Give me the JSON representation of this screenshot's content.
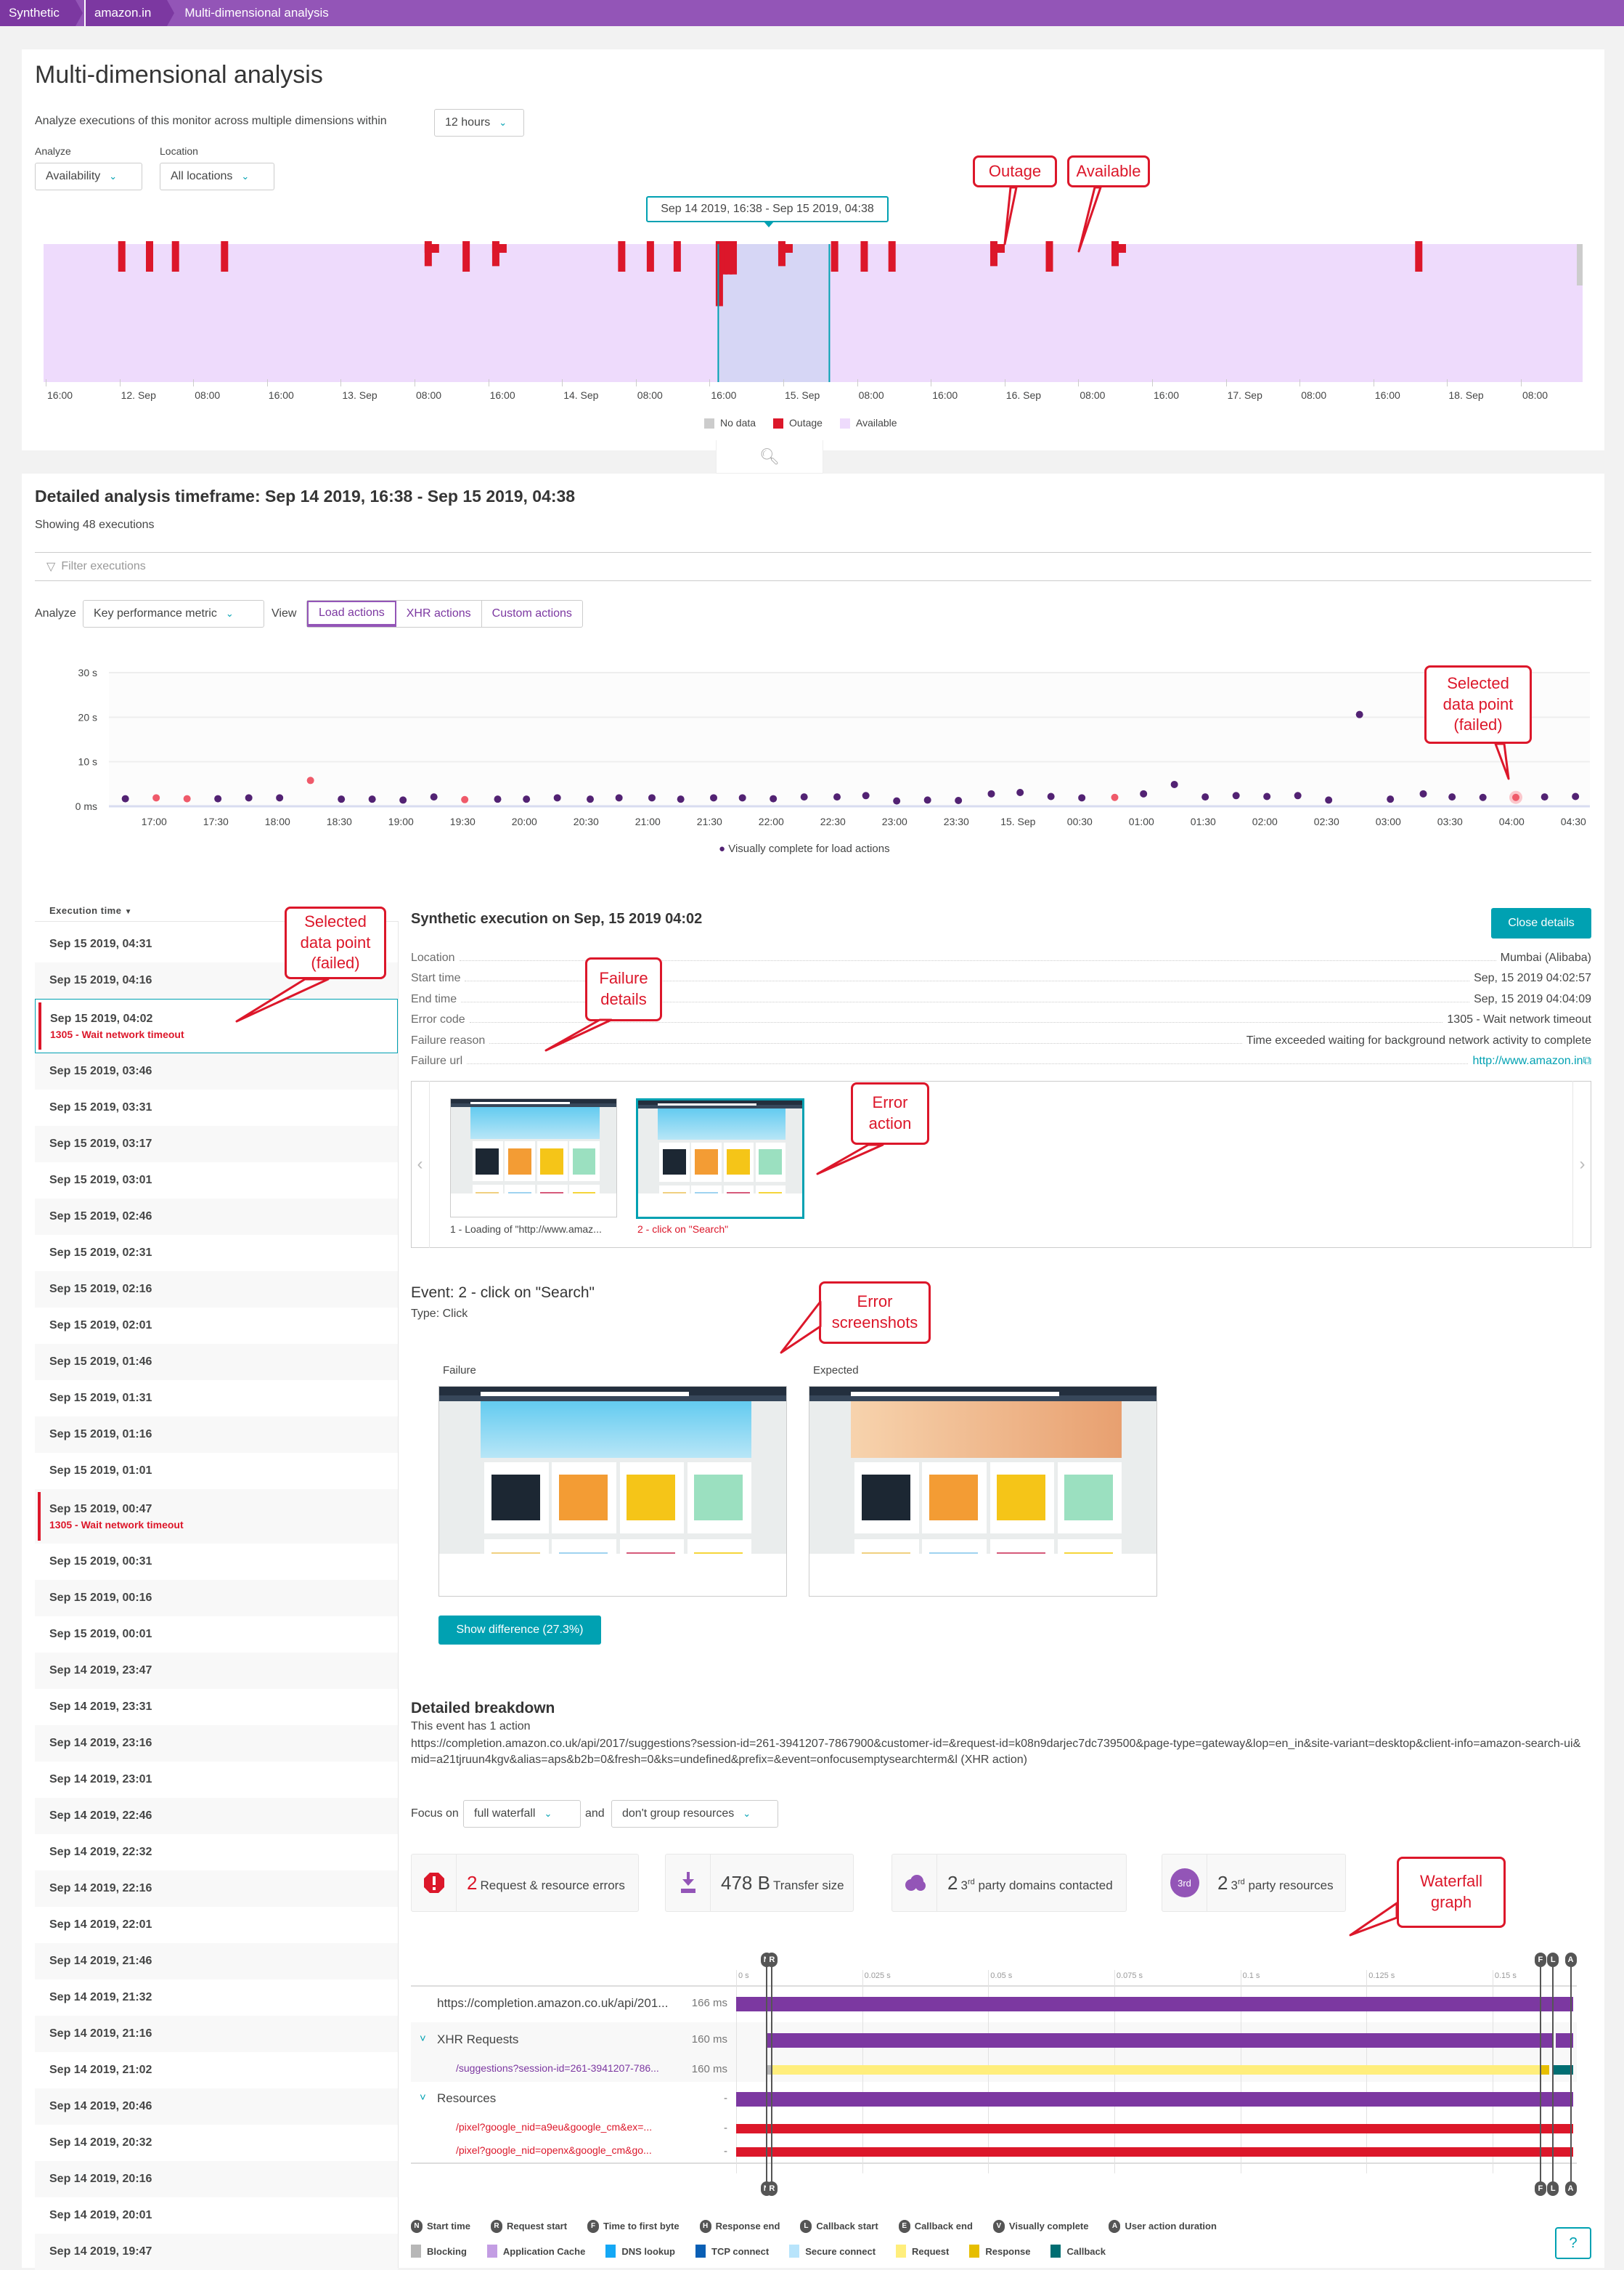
{
  "breadcrumb": [
    "Synthetic",
    "amazon.in",
    "Multi-dimensional analysis"
  ],
  "header": {
    "title": "Multi-dimensional analysis",
    "subtitle": "Analyze executions of this monitor across multiple dimensions within",
    "timeframe": "12 hours",
    "analyze_label": "Analyze",
    "analyze_value": "Availability",
    "location_label": "Location",
    "location_value": "All locations",
    "selection_tooltip": "Sep 14 2019, 16:38 - Sep 15 2019, 04:38"
  },
  "availability_chart": {
    "type": "timeline",
    "range": [
      "2019-09-11T15:45",
      "2019-09-18T14:00"
    ],
    "tick_labels": [
      "16:00",
      "12. Sep",
      "08:00",
      "16:00",
      "13. Sep",
      "08:00",
      "16:00",
      "14. Sep",
      "08:00",
      "16:00",
      "15. Sep",
      "08:00",
      "16:00",
      "16. Sep",
      "08:00",
      "16:00",
      "17. Sep",
      "08:00",
      "16:00",
      "18. Sep",
      "08:00"
    ],
    "selection": [
      "2019-09-14T16:38",
      "2019-09-15T04:38"
    ],
    "outages": [
      {
        "time": "2019-09-12T00:12",
        "outage_pct": 20
      },
      {
        "time": "2019-09-12T03:12",
        "outage_pct": 20
      },
      {
        "time": "2019-09-12T06:00",
        "outage_pct": 20
      },
      {
        "time": "2019-09-12T11:18",
        "outage_pct": 20
      },
      {
        "time": "2019-09-13T09:18",
        "outage_pct": 16
      },
      {
        "time": "2019-09-13T13:24",
        "outage_pct": 20
      },
      {
        "time": "2019-09-13T16:36",
        "outage_pct": 16
      },
      {
        "time": "2019-09-14T06:12",
        "outage_pct": 20
      },
      {
        "time": "2019-09-14T09:18",
        "outage_pct": 20
      },
      {
        "time": "2019-09-14T12:12",
        "outage_pct": 20
      },
      {
        "time": "2019-09-14T16:45",
        "outage_pct": 45
      },
      {
        "time": "2019-09-14T17:15",
        "outage_pct": 22
      },
      {
        "time": "2019-09-14T17:45",
        "outage_pct": 22
      },
      {
        "time": "2019-09-14T18:15",
        "outage_pct": 22
      },
      {
        "time": "2019-09-14T23:30",
        "outage_pct": 16
      },
      {
        "time": "2019-09-15T05:12",
        "outage_pct": 20
      },
      {
        "time": "2019-09-15T08:24",
        "outage_pct": 20
      },
      {
        "time": "2019-09-15T11:24",
        "outage_pct": 20
      },
      {
        "time": "2019-09-15T22:24",
        "outage_pct": 16
      },
      {
        "time": "2019-09-16T04:24",
        "outage_pct": 20
      },
      {
        "time": "2019-09-16T11:30",
        "outage_pct": 16
      },
      {
        "time": "2019-09-17T20:18",
        "outage_pct": 20
      }
    ],
    "no_data": [
      {
        "time": "2019-09-18T13:30",
        "share_pct": 30
      }
    ],
    "legend": [
      {
        "label": "No data",
        "color": "#cccccc"
      },
      {
        "label": "Outage",
        "color": "#dc172a"
      },
      {
        "label": "Available",
        "color": "#eedbfc"
      }
    ]
  },
  "detail": {
    "title": "Detailed analysis timeframe: Sep 14 2019, 16:38 - Sep 15 2019, 04:38",
    "count": "Showing 48 executions",
    "filter_placeholder": "Filter executions",
    "analyze_label": "Analyze",
    "analyze_value": "Key performance metric",
    "view_label": "View",
    "view_tabs": [
      "Load actions",
      "XHR actions",
      "Custom actions"
    ],
    "active_view": "Load actions"
  },
  "chart_data": {
    "type": "scatter",
    "title": "",
    "xlabel": "",
    "ylabel": "",
    "y_ticks": [
      "0 ms",
      "10 s",
      "20 s",
      "30 s"
    ],
    "ylim": [
      0,
      30
    ],
    "y_unit": "s",
    "x_ticks": [
      "17:00",
      "17:30",
      "18:00",
      "18:30",
      "19:00",
      "19:30",
      "20:00",
      "20:30",
      "21:00",
      "21:30",
      "22:00",
      "22:30",
      "23:00",
      "23:30",
      "15. Sep",
      "00:30",
      "01:00",
      "01:30",
      "02:00",
      "02:30",
      "03:00",
      "03:30",
      "04:00",
      "04:30"
    ],
    "xlim": [
      "2019-09-14T16:38",
      "2019-09-15T04:38"
    ],
    "grid": true,
    "legend_placement": "bottom",
    "series": [
      {
        "name": "Visually complete for load actions",
        "color": "#522273",
        "failed_color": "#ef5a6a",
        "x": [
          "16:46",
          "17:01",
          "17:16",
          "17:31",
          "17:46",
          "18:01",
          "18:16",
          "18:31",
          "18:46",
          "19:01",
          "19:16",
          "19:31",
          "19:47",
          "20:01",
          "20:16",
          "20:32",
          "20:46",
          "21:02",
          "21:16",
          "21:32",
          "21:46",
          "22:01",
          "22:16",
          "22:32",
          "22:46",
          "23:01",
          "23:16",
          "23:31",
          "23:47",
          "00:01",
          "00:16",
          "00:31",
          "00:47",
          "01:01",
          "01:16",
          "01:31",
          "01:46",
          "02:01",
          "02:16",
          "02:31",
          "02:46",
          "03:01",
          "03:17",
          "03:31",
          "03:46",
          "04:02",
          "04:16",
          "04:31"
        ],
        "y": [
          1.7,
          1.9,
          1.7,
          1.7,
          1.9,
          1.9,
          5.8,
          1.6,
          1.6,
          1.4,
          2.1,
          1.5,
          1.6,
          1.6,
          1.9,
          1.6,
          1.9,
          1.9,
          1.6,
          1.9,
          1.9,
          1.7,
          2.1,
          2.1,
          2.4,
          1.2,
          1.4,
          1.3,
          2.8,
          3.1,
          2.2,
          1.9,
          2.0,
          2.8,
          4.9,
          2.1,
          2.4,
          2.2,
          2.4,
          1.4,
          20.6,
          1.6,
          2.8,
          2.1,
          2.0,
          2.0,
          2.1,
          2.2
        ],
        "failed": [
          1,
          2,
          6,
          11,
          32,
          45
        ],
        "selected": 45
      }
    ]
  },
  "executions": {
    "header": "Execution time",
    "rows": [
      {
        "time": "Sep 15 2019, 04:31"
      },
      {
        "time": "Sep 15 2019, 04:16"
      },
      {
        "time": "Sep 15 2019, 04:02",
        "error": "1305 - Wait network timeout",
        "selected": true
      },
      {
        "time": "Sep 15 2019, 03:46"
      },
      {
        "time": "Sep 15 2019, 03:31"
      },
      {
        "time": "Sep 15 2019, 03:17"
      },
      {
        "time": "Sep 15 2019, 03:01"
      },
      {
        "time": "Sep 15 2019, 02:46"
      },
      {
        "time": "Sep 15 2019, 02:31"
      },
      {
        "time": "Sep 15 2019, 02:16"
      },
      {
        "time": "Sep 15 2019, 02:01"
      },
      {
        "time": "Sep 15 2019, 01:46"
      },
      {
        "time": "Sep 15 2019, 01:31"
      },
      {
        "time": "Sep 15 2019, 01:16"
      },
      {
        "time": "Sep 15 2019, 01:01"
      },
      {
        "time": "Sep 15 2019, 00:47",
        "error": "1305 - Wait network timeout"
      },
      {
        "time": "Sep 15 2019, 00:31"
      },
      {
        "time": "Sep 15 2019, 00:16"
      },
      {
        "time": "Sep 15 2019, 00:01"
      },
      {
        "time": "Sep 14 2019, 23:47"
      },
      {
        "time": "Sep 14 2019, 23:31"
      },
      {
        "time": "Sep 14 2019, 23:16"
      },
      {
        "time": "Sep 14 2019, 23:01"
      },
      {
        "time": "Sep 14 2019, 22:46"
      },
      {
        "time": "Sep 14 2019, 22:32"
      },
      {
        "time": "Sep 14 2019, 22:16"
      },
      {
        "time": "Sep 14 2019, 22:01"
      },
      {
        "time": "Sep 14 2019, 21:46"
      },
      {
        "time": "Sep 14 2019, 21:32"
      },
      {
        "time": "Sep 14 2019, 21:16"
      },
      {
        "time": "Sep 14 2019, 21:02"
      },
      {
        "time": "Sep 14 2019, 20:46"
      },
      {
        "time": "Sep 14 2019, 20:32"
      },
      {
        "time": "Sep 14 2019, 20:16"
      },
      {
        "time": "Sep 14 2019, 20:01"
      },
      {
        "time": "Sep 14 2019, 19:47"
      }
    ]
  },
  "execution_detail": {
    "title": "Synthetic execution on Sep, 15 2019 04:02",
    "close_label": "Close details",
    "fields": [
      {
        "key": "Location",
        "value": "Mumbai (Alibaba)"
      },
      {
        "key": "Start time",
        "value": "Sep, 15 2019 04:02:57"
      },
      {
        "key": "End time",
        "value": "Sep, 15 2019 04:04:09"
      },
      {
        "key": "Error code",
        "value": "1305 - Wait network timeout"
      },
      {
        "key": "Failure reason",
        "value": "Time exceeded waiting for background network activity to complete"
      },
      {
        "key": "Failure url",
        "value": "http://www.amazon.in",
        "link": true
      }
    ],
    "events": [
      {
        "label": "1 - Loading of \"http://www.amaz...",
        "failed": false
      },
      {
        "label": "2 - click on \"Search\"",
        "failed": true
      }
    ],
    "event_title": "Event: 2 - click on \"Search\"",
    "event_type": "Type: Click",
    "failure_label": "Failure",
    "expected_label": "Expected",
    "show_difference": "Show difference (27.3%)"
  },
  "breakdown": {
    "title": "Detailed breakdown",
    "subtitle": "This event has 1 action",
    "url": "https://completion.amazon.co.uk/api/2017/suggestions?session-id=261-3941207-7867900&customer-id=&request-id=k08n9darjec7dc739500&page-type=gateway&lop=en_in&site-variant=desktop&client-info=amazon-search-ui&mid=a21tjruun4kgv&alias=aps&b2b=0&fresh=0&ks=undefined&prefix=&event=onfocusemptysearchterm&l (XHR action)",
    "focus_label": "Focus on",
    "focus_value": "full waterfall",
    "and_label": "and",
    "group_value": "don't group resources",
    "stats": [
      {
        "value": "2",
        "label": "Request & resource errors",
        "icon": "error-octagon-icon"
      },
      {
        "value": "478 B",
        "label": "Transfer size",
        "icon": "download-icon"
      },
      {
        "value": "2",
        "sup": "rd",
        "label_prefix": "3",
        "label": "party domains contacted",
        "icon": "cloud-icon"
      },
      {
        "value": "2",
        "sup": "rd",
        "label_prefix": "3",
        "label": "party resources",
        "icon": "third-party-badge-icon",
        "badge": "3rd"
      }
    ]
  },
  "waterfall": {
    "axis_ticks": [
      "0 s",
      "0.025 s",
      "0.05 s",
      "0.075 s",
      "0.1 s",
      "0.125 s",
      "0.15 s"
    ],
    "axis_ms": [
      0,
      25,
      50,
      75,
      100,
      125,
      150
    ],
    "total_ms": 166,
    "markers": [
      {
        "letter": "N",
        "ms": 6
      },
      {
        "letter": "R",
        "ms": 7.1
      },
      {
        "letter": "F",
        "ms": 159.5
      },
      {
        "letter": "L",
        "ms": 162
      },
      {
        "letter": "A",
        "ms": 165.5
      }
    ],
    "rows": [
      {
        "label": "https://completion.amazon.co.uk/api/201...",
        "duration": "166 ms",
        "kind": "action",
        "segments": [
          {
            "from": 0,
            "to": 166,
            "color": "#7c38a1"
          }
        ]
      },
      {
        "label": "XHR Requests",
        "duration": "160 ms",
        "kind": "group",
        "segments": [
          {
            "from": 6,
            "to": 162,
            "color": "#7c38a1"
          },
          {
            "from": 162.6,
            "to": 166,
            "color": "#7c38a1"
          }
        ]
      },
      {
        "label": "/suggestions?session-id=261-3941207-786...",
        "duration": "160 ms",
        "kind": "xhr",
        "segments": [
          {
            "from": 6,
            "to": 7.1,
            "color": "#b7b7b7"
          },
          {
            "from": 7.1,
            "to": 159.5,
            "color": "#ffee7c"
          },
          {
            "from": 159.5,
            "to": 161.3,
            "color": "#e6be00"
          },
          {
            "from": 162,
            "to": 166,
            "color": "#006e72"
          }
        ]
      },
      {
        "label": "Resources",
        "duration": "-",
        "kind": "group",
        "segments": [
          {
            "from": 0,
            "to": 166,
            "color": "#7c38a1"
          }
        ]
      },
      {
        "label": "/pixel?google_nid=a9eu&google_cm&ex=...",
        "duration": "-",
        "kind": "error",
        "segments": [
          {
            "from": 0,
            "to": 166,
            "color": "#dc172a"
          }
        ]
      },
      {
        "label": "/pixel?google_nid=openx&google_cm&go...",
        "duration": "-",
        "kind": "error",
        "segments": [
          {
            "from": 0,
            "to": 166,
            "color": "#dc172a"
          }
        ]
      }
    ],
    "legend_markers": [
      {
        "letter": "N",
        "label": "Start time"
      },
      {
        "letter": "R",
        "label": "Request start"
      },
      {
        "letter": "F",
        "label": "Time to first byte"
      },
      {
        "letter": "H",
        "label": "Response end"
      },
      {
        "letter": "L",
        "label": "Callback start"
      },
      {
        "letter": "E",
        "label": "Callback end"
      },
      {
        "letter": "V",
        "label": "Visually complete"
      },
      {
        "letter": "A",
        "label": "User action duration"
      }
    ],
    "legend_phases": [
      {
        "label": "Blocking",
        "color": "#b7b7b7"
      },
      {
        "label": "Application Cache",
        "color": "#c39de3"
      },
      {
        "label": "DNS lookup",
        "color": "#14a8f5"
      },
      {
        "label": "TCP connect",
        "color": "#0a5fb5"
      },
      {
        "label": "Secure connect",
        "color": "#b8e4fb"
      },
      {
        "label": "Request",
        "color": "#ffee7c"
      },
      {
        "label": "Response",
        "color": "#e6be00"
      },
      {
        "label": "Callback",
        "color": "#006e72"
      }
    ],
    "help": "?"
  },
  "annotations": {
    "outage": "Outage",
    "available": "Available",
    "selected_chart": "Selected data point (failed)",
    "selected_list": "Selected data point (failed)",
    "failure_details": "Failure details",
    "error_action": "Error action",
    "error_screenshots": "Error screenshots",
    "waterfall_graph": "Waterfall graph"
  },
  "colors": {
    "brand": "#9355b7",
    "accent": "#00a1b2",
    "error": "#dc172a",
    "available": "#eedbfc",
    "selection": "#d6d6f5"
  }
}
